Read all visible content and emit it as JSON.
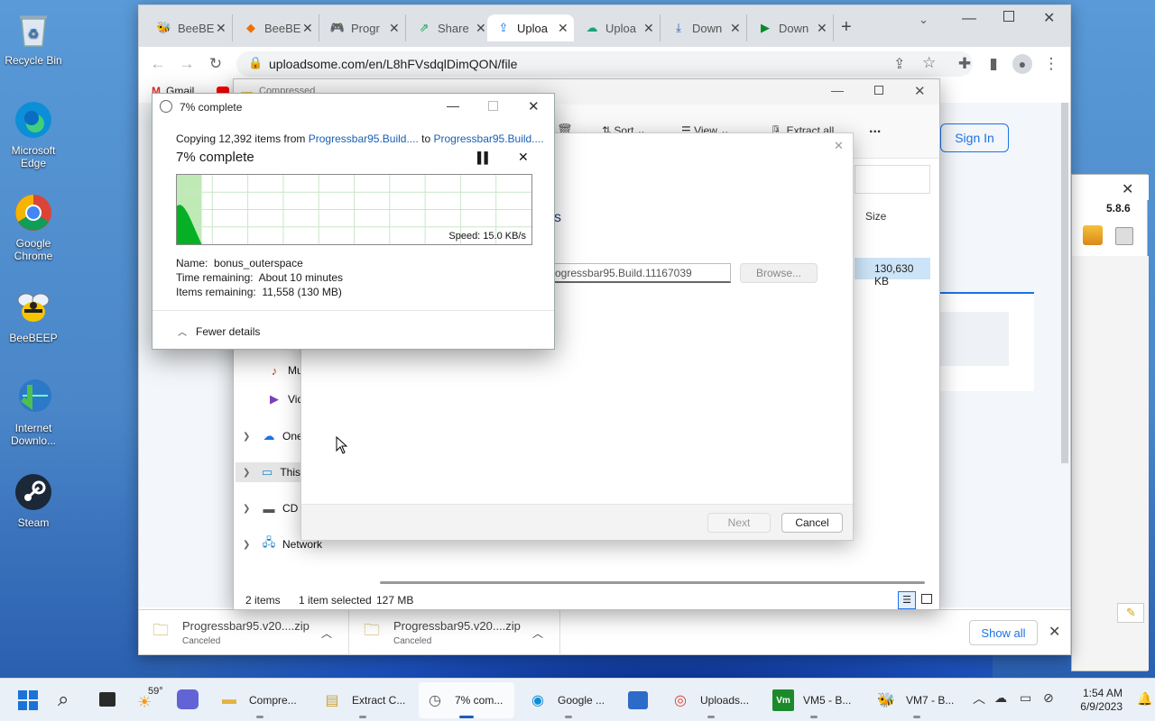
{
  "desktop": {
    "icons": [
      {
        "label": "Recycle Bin",
        "icon": "recycle-bin-icon"
      },
      {
        "label": "Microsoft Edge",
        "icon": "edge-icon"
      },
      {
        "label": "Google Chrome",
        "icon": "chrome-icon"
      },
      {
        "label": "BeeBEEP",
        "icon": "bee-icon"
      },
      {
        "label": "Internet Downlo...",
        "icon": "idm-icon"
      },
      {
        "label": "Steam",
        "icon": "steam-icon"
      }
    ]
  },
  "browser": {
    "tabs": [
      {
        "label": "BeeBE",
        "icon": "bee-icon"
      },
      {
        "label": "BeeBE",
        "icon": "beebeep-site-icon"
      },
      {
        "label": "Progr",
        "icon": "gamepad-icon"
      },
      {
        "label": "Share",
        "icon": "share-icon"
      },
      {
        "label": "Uploa",
        "icon": "upload-icon",
        "active": true
      },
      {
        "label": "Uploa",
        "icon": "upload-cloud-icon"
      },
      {
        "label": "Down",
        "icon": "download-icon"
      },
      {
        "label": "Down",
        "icon": "play-icon"
      }
    ],
    "new_tab": "+",
    "url": "uploadsome.com/en/L8hFVsdqlDimQON/file",
    "bookmarks": [
      {
        "label": "Gmail",
        "icon": "gmail-icon"
      },
      {
        "label": "",
        "icon": "youtube-icon"
      }
    ],
    "page": {
      "sign_in": "Sign In"
    },
    "downloads": [
      {
        "name": "Progressbar95.v20....zip",
        "status": "Canceled"
      },
      {
        "name": "Progressbar95.v20....zip",
        "status": "Canceled"
      }
    ],
    "show_all": "Show all",
    "accent": "#1a73e8"
  },
  "explorer": {
    "title_partial": "Compressed",
    "toolbar": {
      "sort": "Sort",
      "view": "View",
      "extract_all": "Extract all",
      "more": "..."
    },
    "column_size": "Size",
    "file_size": "130,630 KB",
    "tree": [
      {
        "label": "Mu",
        "icon": "music-icon",
        "expandable": false
      },
      {
        "label": "Vid",
        "icon": "video-icon",
        "expandable": false
      },
      {
        "label": "OneI",
        "icon": "onedrive-icon",
        "expandable": true
      },
      {
        "label": "This",
        "icon": "this-pc-icon",
        "expandable": true,
        "selected": true
      },
      {
        "label": "CD D",
        "icon": "cd-drive-icon",
        "expandable": true
      },
      {
        "label": "Network",
        "icon": "network-icon",
        "expandable": true
      }
    ],
    "status": {
      "items": "2 items",
      "selected": "1 item selected",
      "size": "127 MB"
    }
  },
  "wizard": {
    "heading_fragment": "s",
    "path_value": "ogressbar95.Build.11167039",
    "browse": "Browse...",
    "next": "Next",
    "cancel": "Cancel"
  },
  "copy_dialog": {
    "title": "7% complete",
    "copying_prefix": "Copying 12,392 items from ",
    "source": "Progressbar95.Build....",
    "to": " to ",
    "dest": "Progressbar95.Build....",
    "heading": "7% complete",
    "progress_fraction": 0.07,
    "speed": "Speed: 15.0 KB/s",
    "name_label": "Name:",
    "name_value": "bonus_outerspace",
    "time_label": "Time remaining:",
    "time_value": "About 10 minutes",
    "items_label": "Items remaining:",
    "items_value": "11,558 (130 MB)",
    "fewer_details": "Fewer details",
    "graph_color": "#06b025"
  },
  "beebeep": {
    "version": "5.8.6"
  },
  "taskbar": {
    "weather": "59°",
    "apps": [
      {
        "label": "Compre...",
        "icon": "folder-icon"
      },
      {
        "label": "Extract C...",
        "icon": "extract-icon"
      },
      {
        "label": "7% com...",
        "icon": "clock-icon",
        "active": true
      },
      {
        "label": "Google ...",
        "icon": "edge-icon"
      },
      {
        "label": "Uploads...",
        "icon": "chrome-icon"
      },
      {
        "label": "VM5 - B...",
        "icon": "vm-icon"
      },
      {
        "label": "VM7 - B...",
        "icon": "bee-icon"
      }
    ],
    "time": "1:54 AM",
    "date": "6/9/2023"
  }
}
